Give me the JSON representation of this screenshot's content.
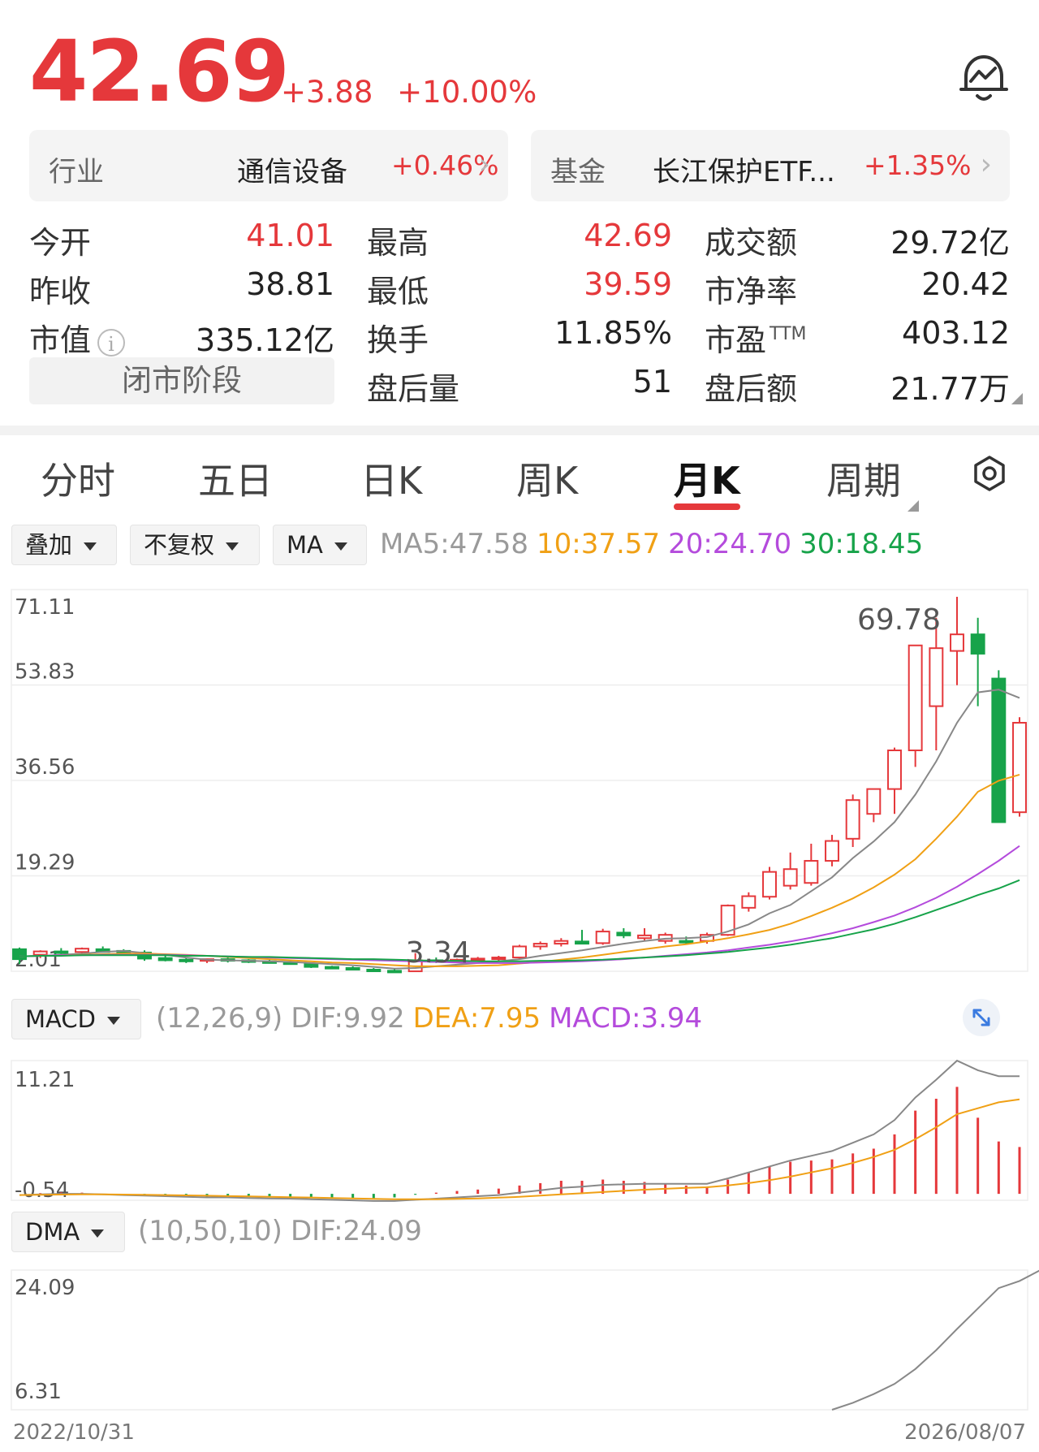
{
  "quote": {
    "price": "42.69",
    "change": "+3.88",
    "change_pct": "+10.00%"
  },
  "industry": {
    "label": "行业",
    "name": "通信设备",
    "pct": "+0.46%"
  },
  "fund": {
    "label": "基金",
    "name": "长江保护ETF...",
    "pct": "+1.35%"
  },
  "stats": {
    "open": {
      "label": "今开",
      "value": "41.01"
    },
    "prev_close": {
      "label": "昨收",
      "value": "38.81"
    },
    "market_cap": {
      "label": "市值",
      "value": "335.12亿"
    },
    "phase": "闭市阶段",
    "high": {
      "label": "最高",
      "value": "42.69"
    },
    "low": {
      "label": "最低",
      "value": "39.59"
    },
    "turnover_rate": {
      "label": "换手",
      "value": "11.85%"
    },
    "after_volume": {
      "label": "盘后量",
      "value": "51"
    },
    "amount": {
      "label": "成交额",
      "value": "29.72亿"
    },
    "pb": {
      "label": "市净率",
      "value": "20.42"
    },
    "pe": {
      "label": "市盈",
      "sup": "TTM",
      "value": "403.12"
    },
    "after_amount": {
      "label": "盘后额",
      "value": "21.77万"
    }
  },
  "tabs": [
    "分时",
    "五日",
    "日K",
    "周K",
    "月K",
    "周期"
  ],
  "active_tab": "月K",
  "controls": {
    "overlay": "叠加",
    "adjust": "不复权",
    "indicator": "MA"
  },
  "ma_legend": {
    "ma5": "MA5:47.58",
    "ma10": "10:37.57",
    "ma20": "20:24.70",
    "ma30": "30:18.45"
  },
  "macd_legend": {
    "name": "MACD",
    "params": "(12,26,9)",
    "dif": "DIF:9.92",
    "dea": "DEA:7.95",
    "macd": "MACD:3.94"
  },
  "dma_legend": {
    "name": "DMA",
    "params": "(10,50,10)",
    "dif": "DIF:24.09"
  },
  "colors": {
    "up": "#e5383b",
    "down": "#17a34a",
    "ma5": "#888888",
    "ma10": "#f0a015",
    "ma20": "#b44bdc",
    "ma30": "#17a34a"
  },
  "chart_data": [
    {
      "type": "candlestick",
      "period": "monthly",
      "x_start": "2022/10/31",
      "x_end": "2026/08/07",
      "y_ticks": [
        "71.11",
        "53.83",
        "36.56",
        "19.29",
        "2.01"
      ],
      "ylim": [
        2.01,
        71.11
      ],
      "max_label": "69.78",
      "min_label": "3.34",
      "candles": [
        [
          6.0,
          6.3,
          3.3,
          4.2
        ],
        [
          5.0,
          5.8,
          4.4,
          5.6
        ],
        [
          5.6,
          6.2,
          5.0,
          5.4
        ],
        [
          5.5,
          6.3,
          5.1,
          6.1
        ],
        [
          6.0,
          6.5,
          5.6,
          5.5
        ],
        [
          5.7,
          6.0,
          5.2,
          5.4
        ],
        [
          5.4,
          5.8,
          3.9,
          4.3
        ],
        [
          4.4,
          4.9,
          3.8,
          4.0
        ],
        [
          4.1,
          4.5,
          3.5,
          3.8
        ],
        [
          3.9,
          4.3,
          3.5,
          4.2
        ],
        [
          4.2,
          4.5,
          3.6,
          4.0
        ],
        [
          4.0,
          4.2,
          3.5,
          3.7
        ],
        [
          3.8,
          4.1,
          3.4,
          3.6
        ],
        [
          3.6,
          3.9,
          3.2,
          3.4
        ],
        [
          3.4,
          3.6,
          2.6,
          2.8
        ],
        [
          2.8,
          3.0,
          2.4,
          2.5
        ],
        [
          2.6,
          2.9,
          2.2,
          2.3
        ],
        [
          2.3,
          2.6,
          2.0,
          2.1
        ],
        [
          2.1,
          2.4,
          1.9,
          2.0
        ],
        [
          2.0,
          5.3,
          2.0,
          4.0
        ],
        [
          4.0,
          4.5,
          3.5,
          3.8
        ],
        [
          3.8,
          4.3,
          3.5,
          4.1
        ],
        [
          4.1,
          4.6,
          3.7,
          4.3
        ],
        [
          4.3,
          4.8,
          3.9,
          4.5
        ],
        [
          4.5,
          6.8,
          4.2,
          6.5
        ],
        [
          6.5,
          7.4,
          5.9,
          7.0
        ],
        [
          7.0,
          8.0,
          6.5,
          7.5
        ],
        [
          7.4,
          9.5,
          7.0,
          7.0
        ],
        [
          7.1,
          9.7,
          6.8,
          9.2
        ],
        [
          9.0,
          9.8,
          8.0,
          8.5
        ],
        [
          8.0,
          9.8,
          7.5,
          8.5
        ],
        [
          7.5,
          9.0,
          7.0,
          8.6
        ],
        [
          7.5,
          8.3,
          6.9,
          7.4
        ],
        [
          7.5,
          9.0,
          7.0,
          8.6
        ],
        [
          8.6,
          14.1,
          8.4,
          13.9
        ],
        [
          13.5,
          16.3,
          12.8,
          15.6
        ],
        [
          15.5,
          20.9,
          15.0,
          20.0
        ],
        [
          17.5,
          23.5,
          16.8,
          20.5
        ],
        [
          18.0,
          25.1,
          17.5,
          22.0
        ],
        [
          22.0,
          26.7,
          21.0,
          25.6
        ],
        [
          26.0,
          34.0,
          24.5,
          33.0
        ],
        [
          30.5,
          34.5,
          29.0,
          35.0
        ],
        [
          35.0,
          42.5,
          30.5,
          42.0
        ],
        [
          42.0,
          61.0,
          39.0,
          61.0
        ],
        [
          50.0,
          66.0,
          42.0,
          60.5
        ],
        [
          60.0,
          69.8,
          53.8,
          63.0
        ],
        [
          63.0,
          66.0,
          50.0,
          59.5
        ],
        [
          55.0,
          56.5,
          36.5,
          29.0
        ],
        [
          30.8,
          48.0,
          30.0,
          47.0
        ]
      ],
      "ma5": [
        4.7,
        4.8,
        5.0,
        5.2,
        5.5,
        5.7,
        5.3,
        5.0,
        4.5,
        4.1,
        4.0,
        3.9,
        3.8,
        3.7,
        3.5,
        3.3,
        3.1,
        2.8,
        2.5,
        2.6,
        2.9,
        3.2,
        3.5,
        3.8,
        4.2,
        4.8,
        5.3,
        5.8,
        6.4,
        7.0,
        7.5,
        7.9,
        8.0,
        8.2,
        9.2,
        10.5,
        12.5,
        14.0,
        16.5,
        19.0,
        22.5,
        25.5,
        29.0,
        34.0,
        40.0,
        47.0,
        52.5,
        53.0,
        51.5
      ],
      "ma10": [
        4.7,
        4.8,
        4.9,
        5.0,
        5.1,
        5.2,
        5.2,
        5.1,
        5.0,
        4.8,
        4.6,
        4.4,
        4.2,
        4.0,
        3.8,
        3.6,
        3.5,
        3.3,
        3.1,
        2.9,
        2.9,
        2.9,
        3.0,
        3.1,
        3.4,
        3.7,
        4.1,
        4.5,
        5.0,
        5.5,
        6.0,
        6.5,
        6.9,
        7.4,
        8.0,
        8.7,
        9.5,
        10.6,
        12.0,
        13.5,
        15.2,
        17.2,
        19.5,
        22.3,
        26.0,
        30.0,
        34.5,
        36.5,
        37.6
      ],
      "ma20": [
        4.7,
        4.8,
        4.9,
        4.9,
        5.0,
        5.0,
        5.0,
        5.0,
        4.9,
        4.8,
        4.7,
        4.6,
        4.5,
        4.4,
        4.3,
        4.2,
        4.1,
        4.0,
        3.9,
        3.8,
        3.7,
        3.6,
        3.5,
        3.5,
        3.5,
        3.6,
        3.7,
        3.8,
        4.0,
        4.2,
        4.5,
        4.8,
        5.1,
        5.4,
        5.8,
        6.3,
        6.8,
        7.4,
        8.1,
        8.9,
        9.8,
        10.9,
        12.1,
        13.6,
        15.3,
        17.3,
        19.6,
        22.0,
        24.7
      ],
      "ma30": [
        4.7,
        4.8,
        4.8,
        4.9,
        4.9,
        4.9,
        4.9,
        4.9,
        4.8,
        4.8,
        4.7,
        4.6,
        4.6,
        4.5,
        4.4,
        4.3,
        4.2,
        4.2,
        4.1,
        4.0,
        3.9,
        3.9,
        3.8,
        3.8,
        3.8,
        3.9,
        3.9,
        4.0,
        4.1,
        4.3,
        4.5,
        4.7,
        4.9,
        5.2,
        5.5,
        5.9,
        6.3,
        6.8,
        7.4,
        8.0,
        8.8,
        9.6,
        10.6,
        11.8,
        13.1,
        14.4,
        15.8,
        17.0,
        18.5
      ]
    },
    {
      "type": "macd",
      "y_ticks": [
        "11.21",
        "-0.54"
      ],
      "ylim": [
        -0.54,
        11.21
      ],
      "dif": [
        -0.1,
        -0.05,
        0,
        0,
        -0.05,
        -0.1,
        -0.15,
        -0.2,
        -0.25,
        -0.3,
        -0.3,
        -0.35,
        -0.38,
        -0.4,
        -0.45,
        -0.5,
        -0.55,
        -0.6,
        -0.6,
        -0.5,
        -0.4,
        -0.3,
        -0.2,
        -0.1,
        0.1,
        0.3,
        0.5,
        0.6,
        0.75,
        0.8,
        0.85,
        0.85,
        0.85,
        0.85,
        1.3,
        1.8,
        2.3,
        2.8,
        3.2,
        3.6,
        4.3,
        5.0,
        6.2,
        8.1,
        9.6,
        11.2,
        10.4,
        9.9,
        9.9
      ],
      "dea": [
        -0.1,
        -0.08,
        -0.06,
        -0.05,
        -0.05,
        -0.06,
        -0.08,
        -0.1,
        -0.13,
        -0.16,
        -0.19,
        -0.22,
        -0.25,
        -0.28,
        -0.31,
        -0.35,
        -0.38,
        -0.42,
        -0.45,
        -0.46,
        -0.45,
        -0.42,
        -0.38,
        -0.32,
        -0.25,
        -0.15,
        -0.05,
        0.05,
        0.15,
        0.25,
        0.35,
        0.42,
        0.5,
        0.55,
        0.7,
        0.9,
        1.15,
        1.45,
        1.8,
        2.15,
        2.6,
        3.1,
        3.7,
        4.6,
        5.6,
        6.7,
        7.2,
        7.7,
        7.95
      ],
      "hist": [
        0,
        0.06,
        0.12,
        0.1,
        0,
        -0.08,
        -0.14,
        -0.2,
        -0.24,
        -0.28,
        -0.22,
        -0.26,
        -0.26,
        -0.24,
        -0.28,
        -0.3,
        -0.34,
        -0.36,
        -0.3,
        -0.08,
        0.1,
        0.24,
        0.36,
        0.44,
        0.7,
        0.9,
        1.1,
        1.1,
        1.2,
        1.1,
        1.0,
        0.86,
        0.7,
        0.6,
        1.2,
        1.8,
        2.3,
        2.7,
        2.8,
        2.9,
        3.4,
        3.8,
        5.0,
        7.0,
        8.0,
        9.0,
        6.4,
        4.4,
        3.94
      ]
    },
    {
      "type": "dma",
      "y_ticks": [
        "24.09",
        "6.31"
      ],
      "ylim": [
        6.31,
        24.09
      ],
      "x_start_index": 39,
      "dif": [
        6.31,
        7.2,
        8.3,
        9.6,
        11.5,
        13.9,
        16.6,
        19.2,
        21.8,
        22.7,
        24.09
      ]
    }
  ]
}
